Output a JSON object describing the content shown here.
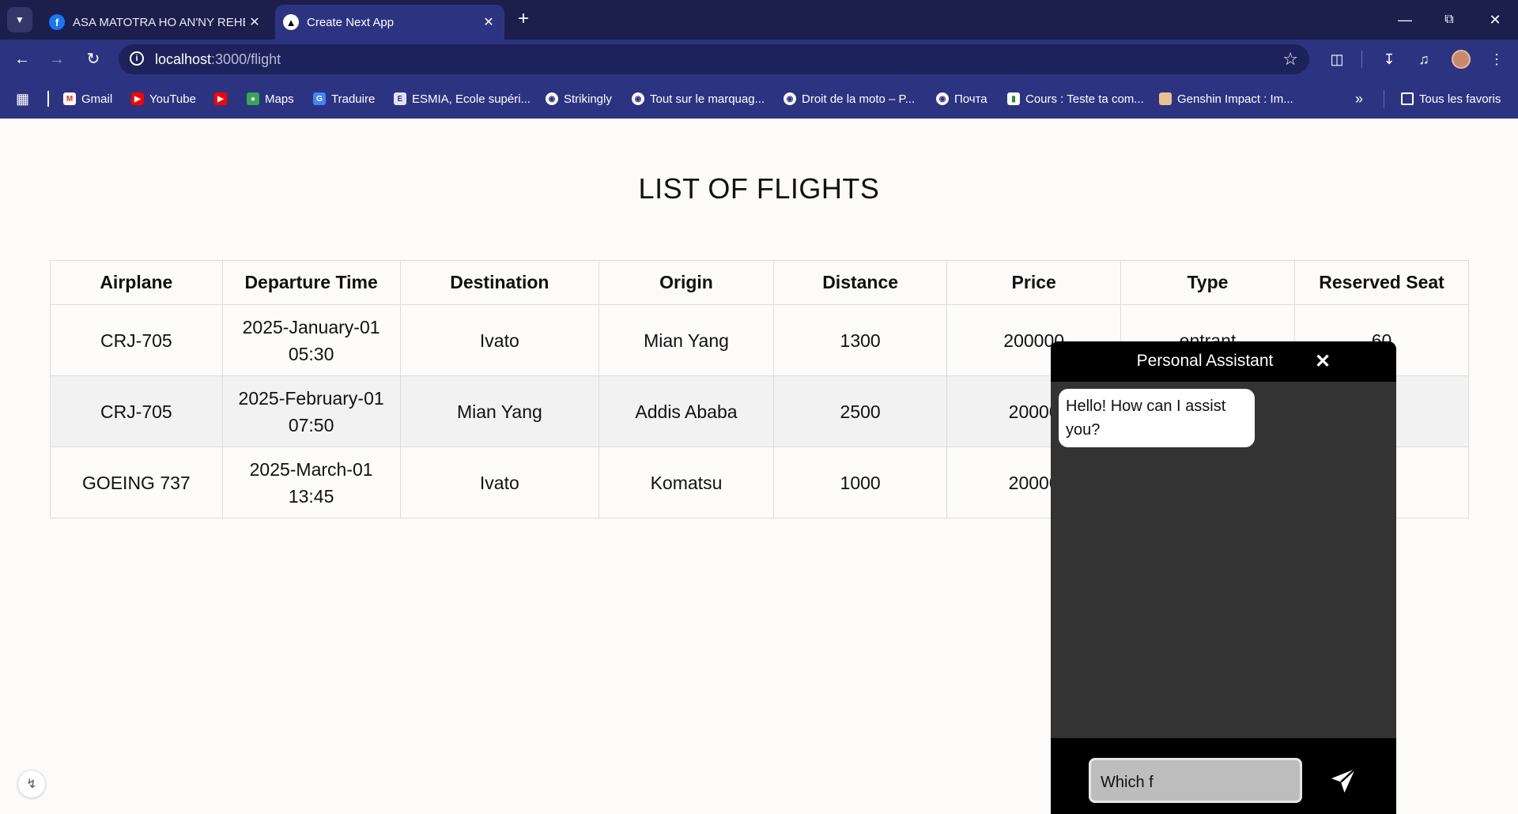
{
  "browser": {
    "tabs": [
      {
        "title": "ASA MATOTRA HO AN'NY REHETRA",
        "favicon": "facebook-icon",
        "active": false
      },
      {
        "title": "Create Next App",
        "favicon": "nextjs-icon",
        "active": true
      }
    ],
    "address": {
      "host": "localhost",
      "path": ":3000/flight"
    },
    "bookmarks": [
      {
        "label": "Gmail",
        "icon": "gmail-icon"
      },
      {
        "label": "YouTube",
        "icon": "youtube-icon"
      },
      {
        "label": "",
        "icon": "youtube-icon"
      },
      {
        "label": "Maps",
        "icon": "maps-icon"
      },
      {
        "label": "Traduire",
        "icon": "translate-icon"
      },
      {
        "label": "ESMIA, Ecole supéri...",
        "icon": "esmia-icon"
      },
      {
        "label": "Strikingly",
        "icon": "globe-icon"
      },
      {
        "label": "Tout sur le marquag...",
        "icon": "globe-icon"
      },
      {
        "label": "Droit de la moto – P...",
        "icon": "globe-icon"
      },
      {
        "label": "Почта",
        "icon": "globe-icon"
      },
      {
        "label": "Cours : Teste ta com...",
        "icon": "chart-icon"
      },
      {
        "label": "Genshin Impact : Im...",
        "icon": "genshin-icon"
      }
    ],
    "all_bookmarks_label": "Tous les favoris",
    "colors": {
      "frame": "#1c1f4c",
      "toolbar": "#2c3482"
    }
  },
  "page": {
    "title": "LIST OF FLIGHTS",
    "table": {
      "headers": [
        "Airplane",
        "Departure Time",
        "Destination",
        "Origin",
        "Distance",
        "Price",
        "Type",
        "Reserved Seat"
      ],
      "rows": [
        {
          "airplane": "CRJ-705",
          "departure_date": "2025-January-01",
          "departure_time": "05:30",
          "destination": "Ivato",
          "origin": "Mian Yang",
          "distance": "1300",
          "price": "200000",
          "type": "entrant",
          "reserved_seat": "60"
        },
        {
          "airplane": "CRJ-705",
          "departure_date": "2025-February-01",
          "departure_time": "07:50",
          "destination": "Mian Yang",
          "origin": "Addis Ababa",
          "distance": "2500",
          "price": "20000",
          "type": "",
          "reserved_seat": ""
        },
        {
          "airplane": "GOEING 737",
          "departure_date": "2025-March-01",
          "departure_time": "13:45",
          "destination": "Ivato",
          "origin": "Komatsu",
          "distance": "1000",
          "price": "20000",
          "type": "",
          "reserved_seat": ""
        }
      ]
    }
  },
  "assistant": {
    "title": "Personal Assistant",
    "close_label": "✕",
    "messages": [
      {
        "from": "bot",
        "text": "Hello! How can I assist you?"
      }
    ],
    "input_value": "Which f",
    "colors": {
      "header": "#000000",
      "body": "#333333"
    }
  }
}
